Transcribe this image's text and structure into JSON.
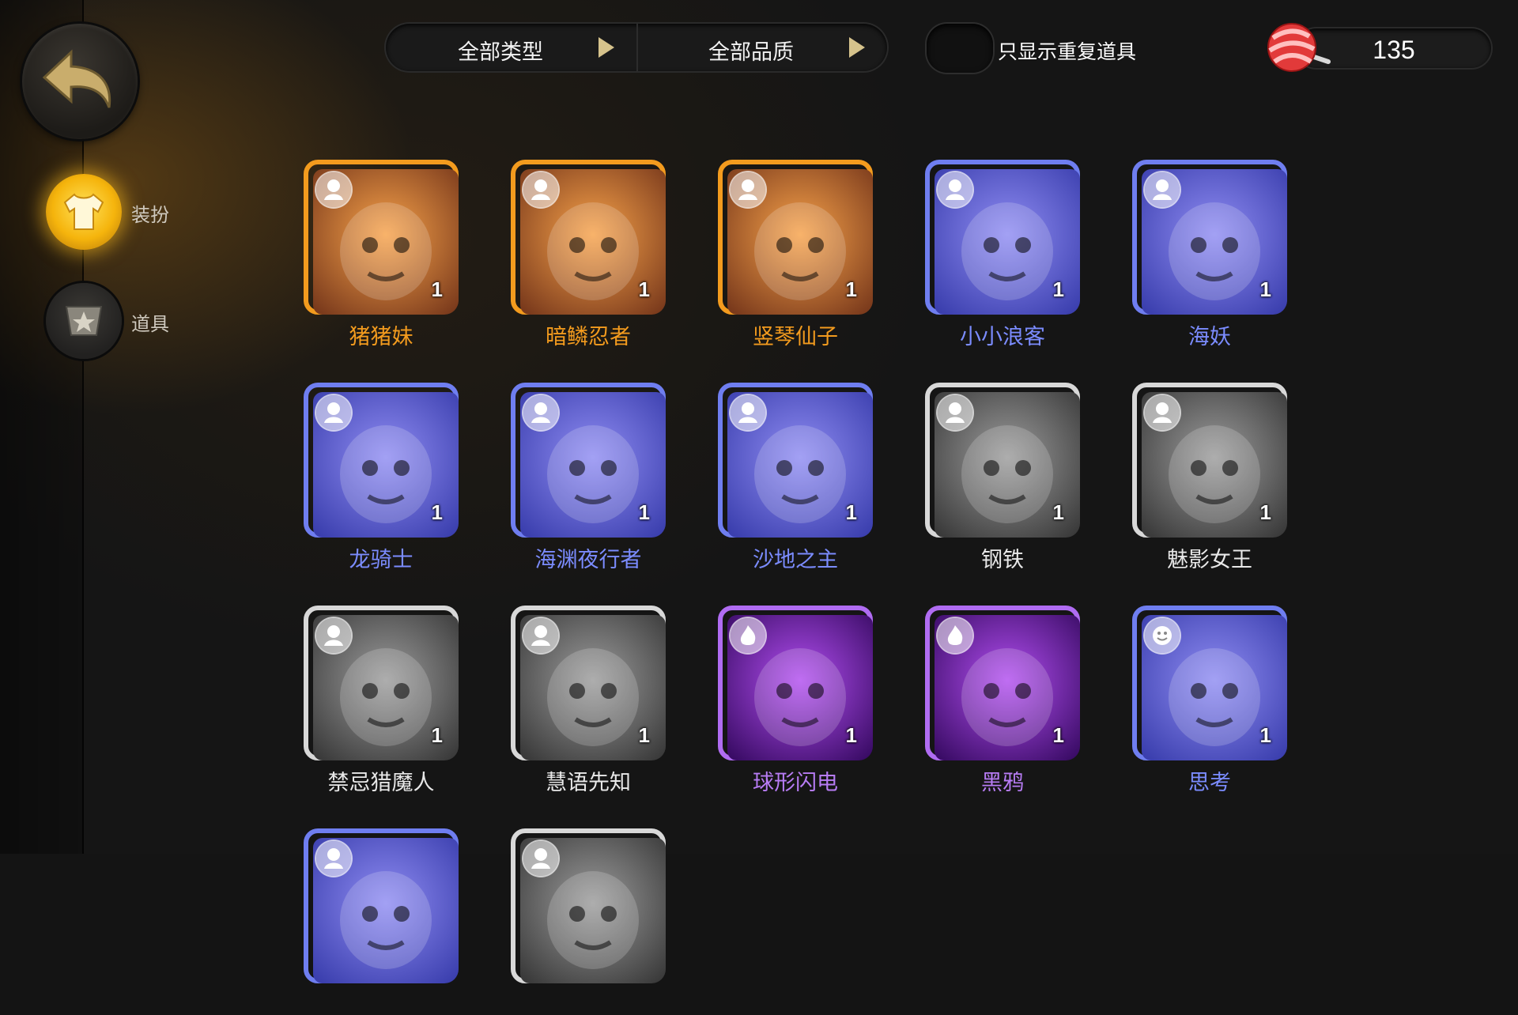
{
  "colors": {
    "orange_quality": "#f39b1e",
    "blue_quality": "#6f7ef0",
    "grey_quality": "#d8d8d8",
    "purple_quality": "#b06cf2",
    "active_nav": "#f5b40c"
  },
  "sidebar": {
    "back_icon": "back-arrow-icon",
    "items": [
      {
        "label": "装扮",
        "icon": "outfit-shirt-icon",
        "active": true
      },
      {
        "label": "道具",
        "icon": "item-badge-icon",
        "active": false
      }
    ]
  },
  "filters": {
    "type_label": "全部类型",
    "quality_label": "全部品质",
    "duplicate_toggle_label": "只显示重复道具",
    "duplicate_toggle_on": false
  },
  "currency": {
    "icon": "candy-icon",
    "value": "135"
  },
  "items": [
    {
      "name": "猪猪妹",
      "count": "1",
      "quality": "orange",
      "badge": "avatar-frame-icon"
    },
    {
      "name": "暗鳞忍者",
      "count": "1",
      "quality": "orange",
      "badge": "avatar-frame-icon"
    },
    {
      "name": "竖琴仙子",
      "count": "1",
      "quality": "orange",
      "badge": "avatar-frame-icon"
    },
    {
      "name": "小小浪客",
      "count": "1",
      "quality": "blue",
      "badge": "avatar-icon"
    },
    {
      "name": "海妖",
      "count": "1",
      "quality": "blue",
      "badge": "avatar-icon"
    },
    {
      "name": "龙骑士",
      "count": "1",
      "quality": "blue",
      "badge": "avatar-icon"
    },
    {
      "name": "海渊夜行者",
      "count": "1",
      "quality": "blue",
      "badge": "avatar-icon"
    },
    {
      "name": "沙地之主",
      "count": "1",
      "quality": "blue",
      "badge": "avatar-icon"
    },
    {
      "name": "钢铁",
      "count": "1",
      "quality": "grey",
      "badge": "avatar-icon"
    },
    {
      "name": "魅影女王",
      "count": "1",
      "quality": "grey",
      "badge": "avatar-icon"
    },
    {
      "name": "禁忌猎魔人",
      "count": "1",
      "quality": "grey",
      "badge": "avatar-icon"
    },
    {
      "name": "慧语先知",
      "count": "1",
      "quality": "grey",
      "badge": "avatar-icon"
    },
    {
      "name": "球形闪电",
      "count": "1",
      "quality": "purple",
      "badge": "flame-icon"
    },
    {
      "name": "黑鸦",
      "count": "1",
      "quality": "purple",
      "badge": "flame-icon"
    },
    {
      "name": "思考",
      "count": "1",
      "quality": "blue",
      "badge": "emote-icon"
    },
    {
      "name": "",
      "count": "",
      "quality": "blue",
      "badge": "avatar-icon"
    },
    {
      "name": "",
      "count": "",
      "quality": "grey",
      "badge": "avatar-icon"
    }
  ]
}
